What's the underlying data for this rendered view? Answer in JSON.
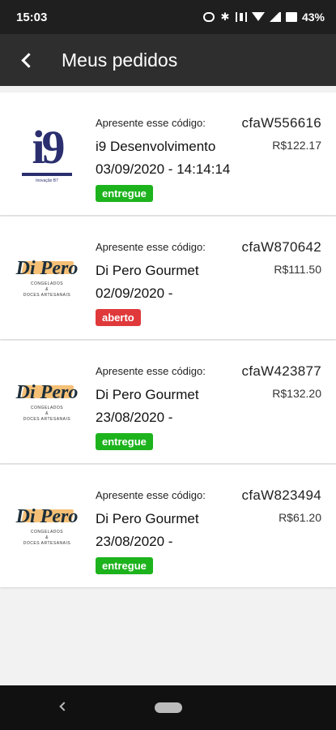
{
  "status_bar": {
    "time": "15:03",
    "battery": "43%",
    "icons": [
      "key-icon",
      "bluetooth-icon",
      "vibrate-icon",
      "wifi-icon",
      "signal-icon",
      "battery-icon"
    ]
  },
  "app_bar": {
    "title": "Meus pedidos",
    "back_icon": "arrow-back-icon"
  },
  "orders": [
    {
      "label": "Apresente esse código:",
      "code": "cfaW556616",
      "price": "R$122.17",
      "store": "i9 Desenvolvimento",
      "date": "03/09/2020 - 14:14:14",
      "status": "entregue",
      "status_color": "#1db31d",
      "logo": {
        "type": "i9",
        "mark": "i9",
        "sub": "Inovação B7"
      }
    },
    {
      "label": "Apresente esse código:",
      "code": "cfaW870642",
      "price": "R$111.50",
      "store": "Di Pero Gourmet",
      "date": "02/09/2020 -",
      "status": "aberto",
      "status_color": "#e0393b",
      "logo": {
        "type": "dipero",
        "script": "Di Pero",
        "tag1": "CONGELADOS",
        "tag2": "&",
        "tag3": "DOCES ARTESANAIS"
      }
    },
    {
      "label": "Apresente esse código:",
      "code": "cfaW423877",
      "price": "R$132.20",
      "store": "Di Pero Gourmet",
      "date": "23/08/2020 -",
      "status": "entregue",
      "status_color": "#1db31d",
      "logo": {
        "type": "dipero",
        "script": "Di Pero",
        "tag1": "CONGELADOS",
        "tag2": "&",
        "tag3": "DOCES ARTESANAIS"
      }
    },
    {
      "label": "Apresente esse código:",
      "code": "cfaW823494",
      "price": "R$61.20",
      "store": "Di Pero Gourmet",
      "date": "23/08/2020 -",
      "status": "entregue",
      "status_color": "#1db31d",
      "logo": {
        "type": "dipero",
        "script": "Di Pero",
        "tag1": "CONGELADOS",
        "tag2": "&",
        "tag3": "DOCES ARTESANAIS"
      }
    }
  ],
  "colors": {
    "app_bar": "#2e2e2e",
    "status_bar": "#1f1f1f",
    "entregue": "#1db31d",
    "aberto": "#e0393b"
  }
}
